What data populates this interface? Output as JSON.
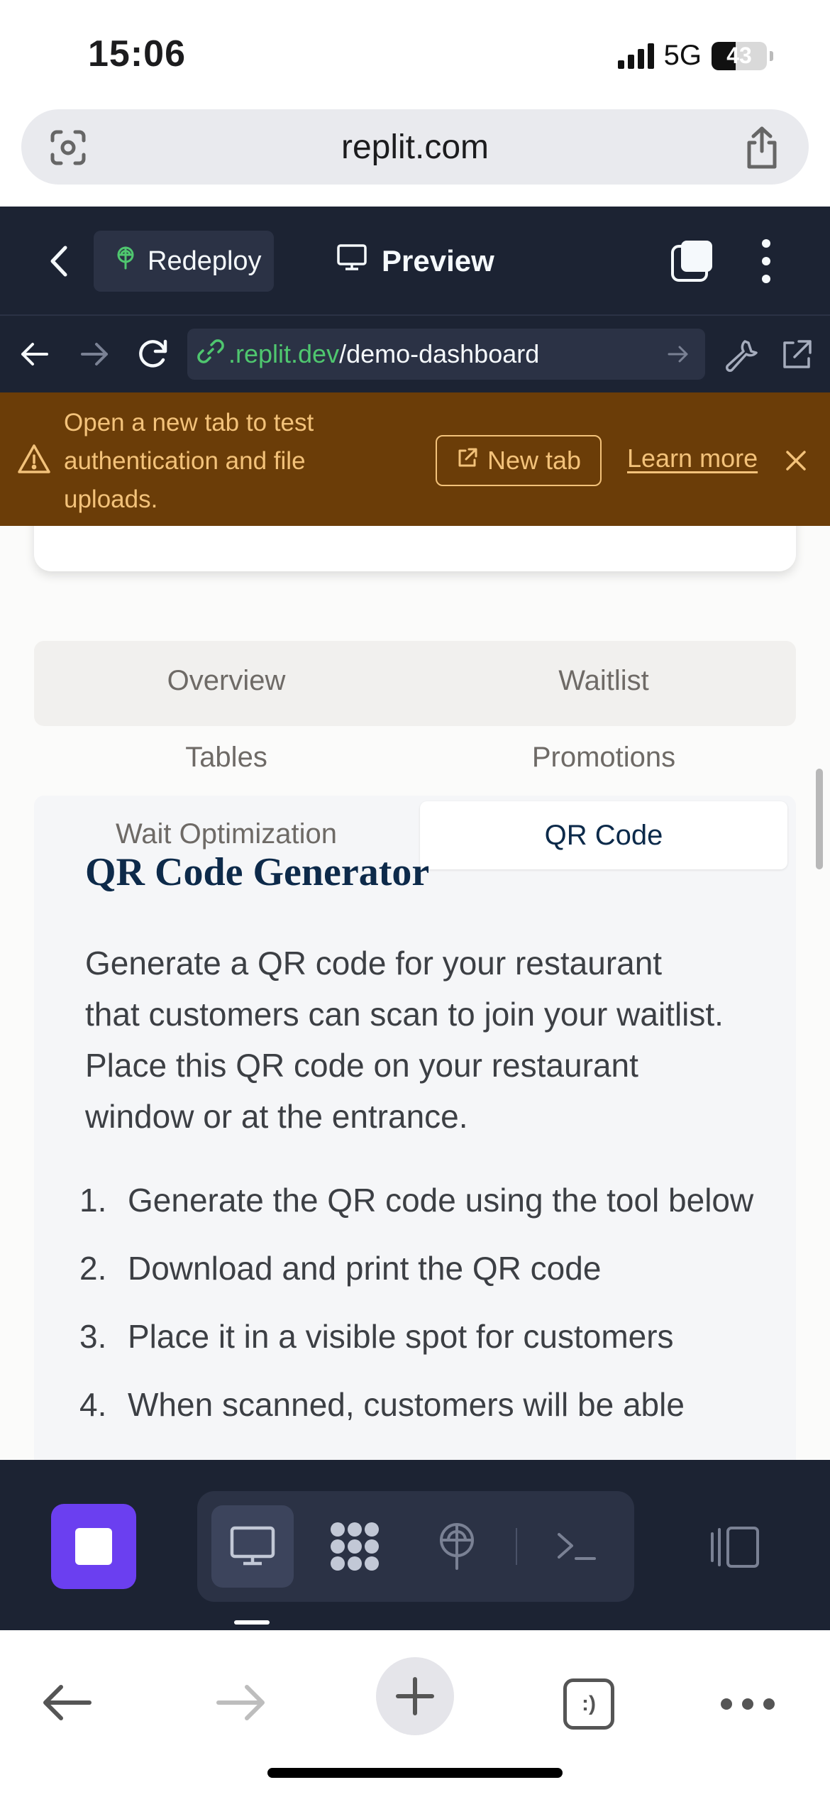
{
  "status_bar": {
    "time": "15:06",
    "network": "5G",
    "battery": "43",
    "battery_level": 0.43
  },
  "browser": {
    "domain": "replit.com"
  },
  "replit_header": {
    "redeploy_label": "Redeploy",
    "preview_label": "Preview"
  },
  "replit_nav": {
    "url_host": ".replit.dev",
    "url_path": "/demo-dashboard"
  },
  "banner": {
    "message": "Open a new tab to test authentication and file uploads.",
    "new_tab_label": "New tab",
    "learn_more_label": "Learn more"
  },
  "tabs": {
    "overview": "Overview",
    "waitlist": "Waitlist",
    "tables": "Tables",
    "promotions": "Promotions",
    "wait_optimization": "Wait Optimization",
    "qr_code": "QR Code"
  },
  "panel": {
    "title": "QR Code Generator",
    "description": "Generate a QR code for your restaurant that customers can scan to join your waitlist. Place this QR code on your restaurant window or at the entrance.",
    "steps": [
      {
        "num": "1.",
        "text": "Generate the QR code using the tool below"
      },
      {
        "num": "2.",
        "text": "Download and print the QR code"
      },
      {
        "num": "3.",
        "text": "Place it in a visible spot for customers"
      },
      {
        "num": "4.",
        "text": "When scanned, customers will be able"
      }
    ]
  },
  "safari_toolbar": {
    "tabs_label": ":)"
  },
  "icons": {
    "status": [
      "signal-icon",
      "battery-icon"
    ],
    "browser": [
      "camera-scan-icon",
      "share-icon"
    ],
    "replit": [
      "chevron-left-icon",
      "deploy-icon",
      "monitor-icon",
      "tabs-icon",
      "more-vertical-icon",
      "arrow-left-icon",
      "arrow-right-icon",
      "reload-icon",
      "link-icon",
      "arrow-go-icon",
      "wrench-icon",
      "external-link-icon"
    ],
    "banner": [
      "warning-icon",
      "external-link-icon",
      "close-icon"
    ],
    "bottom": [
      "stop-icon",
      "monitor-icon",
      "apps-grid-icon",
      "deploy-icon",
      "terminal-icon",
      "panel-toggle-icon"
    ],
    "safari": [
      "back-icon",
      "forward-icon",
      "plus-icon",
      "tabs-icon",
      "more-icon"
    ]
  },
  "colors": {
    "replit_dark": "#1c2333",
    "replit_surface": "#2b3245",
    "banner_bg": "#6b3d08",
    "banner_text": "#f3c27a",
    "link_green": "#4fc76f",
    "run_purple": "#6b3ff0",
    "title_navy": "#0d2a4a"
  }
}
